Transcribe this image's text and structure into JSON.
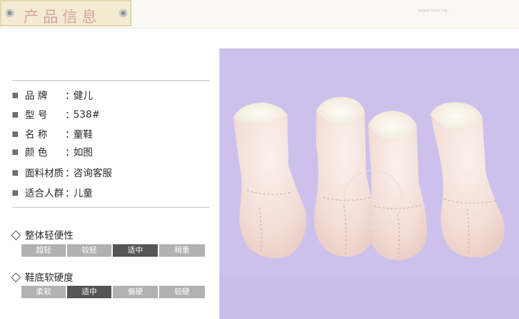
{
  "header": {
    "title": "产品信息",
    "small_text": "SOOLOO GIUDIY CUB...",
    "pin_left_icon": "pin-icon",
    "pin_right_icon": "pin-icon"
  },
  "info": [
    {
      "label": "品    牌",
      "colon": "：",
      "value": "健儿"
    },
    {
      "label": "型    号",
      "colon": "：",
      "value": "538#"
    },
    {
      "label": "名    称",
      "colon": "：",
      "value": "童鞋"
    },
    {
      "label": "颜    色",
      "colon": "：",
      "value": "如图"
    },
    {
      "label": "面料材质",
      "colon": "：",
      "value": "咨询客服"
    },
    {
      "label": "适合人群",
      "colon": "：",
      "value": "儿童"
    }
  ],
  "weight_section": {
    "title": "整体轻便性",
    "options": [
      "超轻",
      "较轻",
      "适中",
      "稍重"
    ],
    "selected": 2
  },
  "sole_section": {
    "title": "鞋底软硬度",
    "options": [
      "柔软",
      "适中",
      "偏硬",
      "较硬"
    ],
    "selected": 1
  },
  "colors": {
    "photo_bg": "#cdc1ec",
    "seg_selected": "#555555",
    "seg_default": "#b1b1b1",
    "title_text": "#d7a3a3"
  }
}
